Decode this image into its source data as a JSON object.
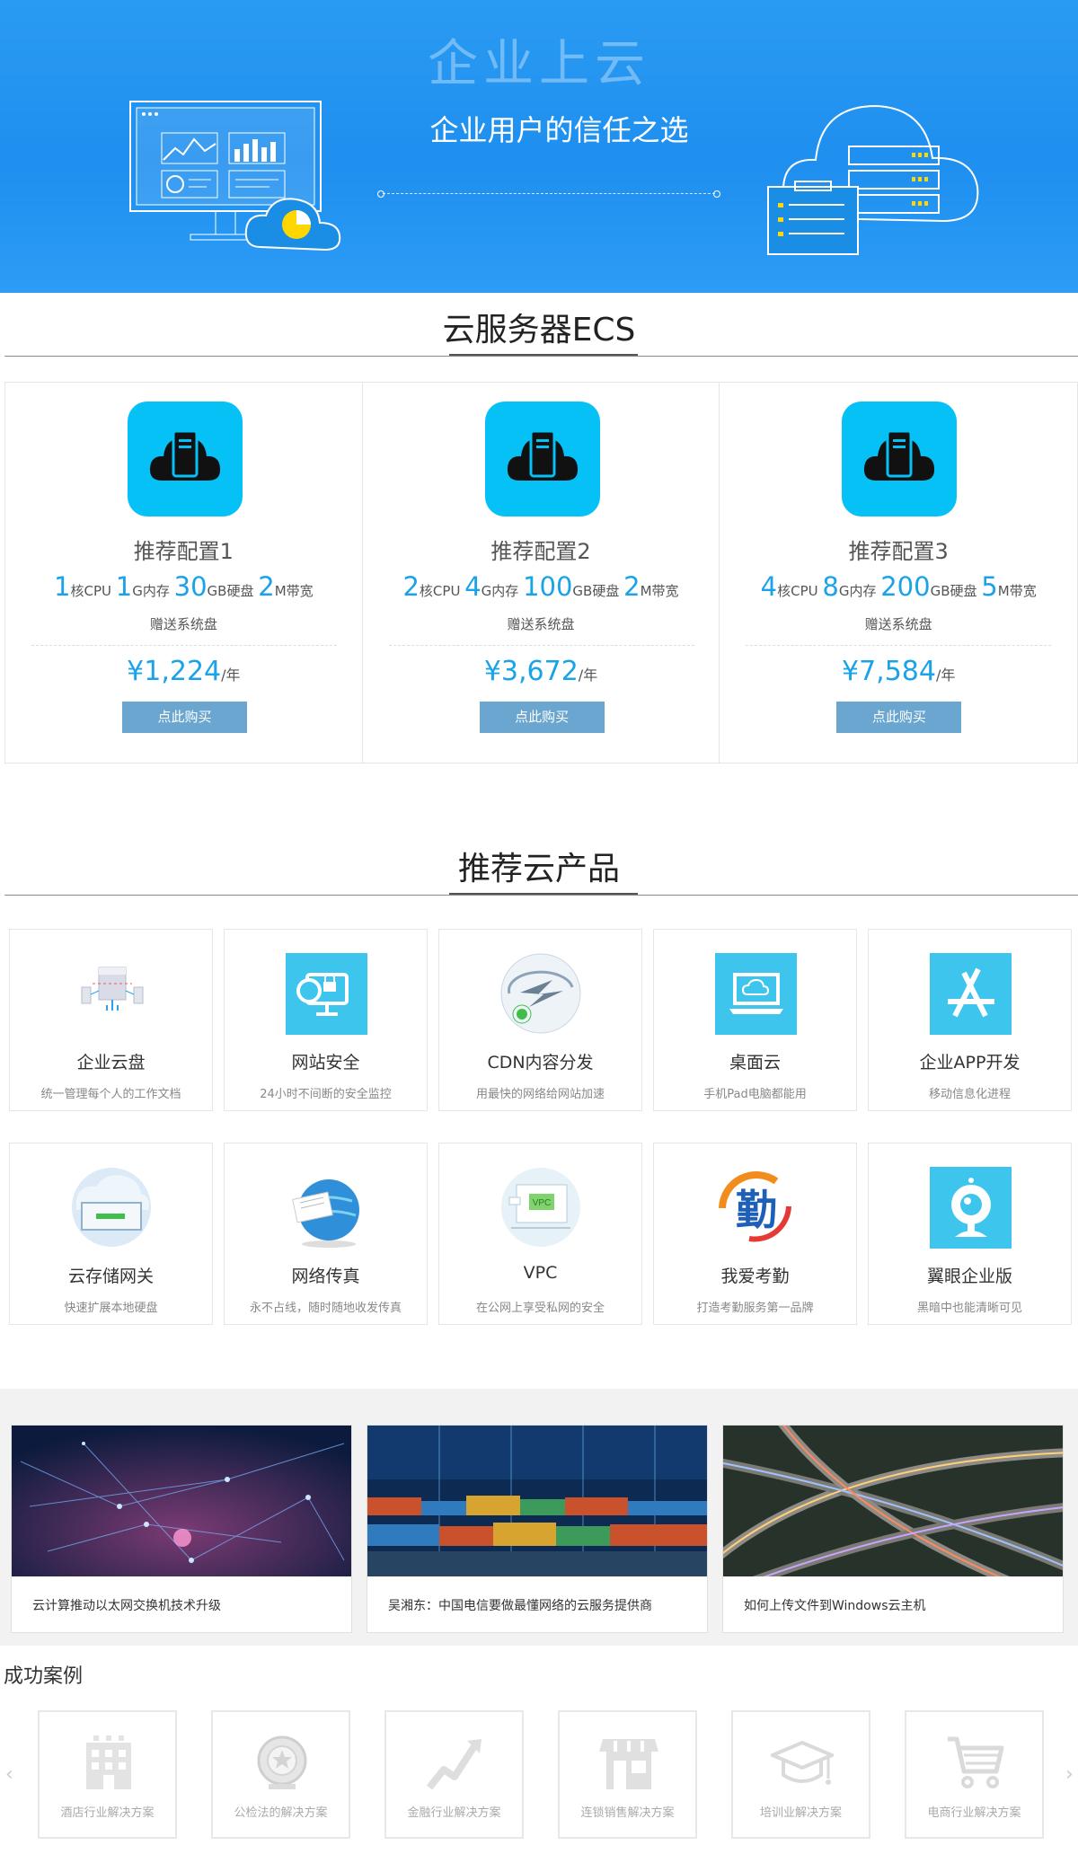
{
  "hero": {
    "title": "企业上云",
    "subtitle": "企业用户的信任之选"
  },
  "ecs": {
    "section_title": "云服务器ECS",
    "cards": [
      {
        "name": "推荐配置1",
        "cpu": "1",
        "cpu_unit": "核CPU",
        "mem": "1",
        "mem_unit": "G内存",
        "disk": "30",
        "disk_unit": "GB硬盘",
        "bw": "2",
        "bw_unit": "M带宽",
        "gift": "赠送系统盘",
        "price": "¥1,224",
        "per": "/年",
        "buy": "点此购买"
      },
      {
        "name": "推荐配置2",
        "cpu": "2",
        "cpu_unit": "核CPU",
        "mem": "4",
        "mem_unit": "G内存",
        "disk": "100",
        "disk_unit": "GB硬盘",
        "bw": "2",
        "bw_unit": "M带宽",
        "gift": "赠送系统盘",
        "price": "¥3,672",
        "per": "/年",
        "buy": "点此购买"
      },
      {
        "name": "推荐配置3",
        "cpu": "4",
        "cpu_unit": "核CPU",
        "mem": "8",
        "mem_unit": "G内存",
        "disk": "200",
        "disk_unit": "GB硬盘",
        "bw": "5",
        "bw_unit": "M带宽",
        "gift": "赠送系统盘",
        "price": "¥7,584",
        "per": "/年",
        "buy": "点此购买"
      }
    ]
  },
  "products": {
    "section_title": "推荐云产品",
    "items": [
      {
        "name": "企业云盘",
        "desc": "统一管理每个人的工作文档",
        "icon": "cloud-disk-icon"
      },
      {
        "name": "网站安全",
        "desc": "24小时不间断的安全监控",
        "icon": "web-security-icon"
      },
      {
        "name": "CDN内容分发",
        "desc": "用最快的网络给网站加速",
        "icon": "cdn-icon"
      },
      {
        "name": "桌面云",
        "desc": "手机Pad电脑都能用",
        "icon": "desktop-cloud-icon"
      },
      {
        "name": "企业APP开发",
        "desc": "移动信息化进程",
        "icon": "app-dev-icon"
      },
      {
        "name": "云存储网关",
        "desc": "快速扩展本地硬盘",
        "icon": "storage-gateway-icon"
      },
      {
        "name": "网络传真",
        "desc": "永不占线，随时随地收发传真",
        "icon": "network-fax-icon"
      },
      {
        "name": "VPC",
        "desc": "在公网上享受私网的安全",
        "icon": "vpc-icon",
        "icon_text": "VPC"
      },
      {
        "name": "我爱考勤",
        "desc": "打造考勤服务第一品牌",
        "icon": "attendance-icon",
        "icon_text": "勤"
      },
      {
        "name": "翼眼企业版",
        "desc": "黑暗中也能清晰可见",
        "icon": "camera-icon"
      }
    ]
  },
  "news": [
    {
      "caption": "云计算推动以太网交换机技术升级"
    },
    {
      "caption": "吴湘东：中国电信要做最懂网络的云服务提供商"
    },
    {
      "caption": "如何上传文件到Windows云主机"
    }
  ],
  "cases": {
    "title": "成功案例",
    "items": [
      {
        "label": "酒店行业解决方案",
        "icon": "hotel-icon"
      },
      {
        "label": "公检法的解决方案",
        "icon": "emblem-icon"
      },
      {
        "label": "金融行业解决方案",
        "icon": "finance-chart-icon"
      },
      {
        "label": "连锁销售解决方案",
        "icon": "store-icon"
      },
      {
        "label": "培训业解决方案",
        "icon": "graduation-cap-icon"
      },
      {
        "label": "电商行业解决方案",
        "icon": "shopping-cart-icon"
      }
    ],
    "prev": "‹",
    "next": "›"
  },
  "colors": {
    "hero_blue": "#2a9bf2",
    "accent": "#1aa3e8",
    "ecs_icon_bg": "#05c1f5",
    "buy_button": "#6aa6cf",
    "product_tile": "#3ec5ee"
  }
}
